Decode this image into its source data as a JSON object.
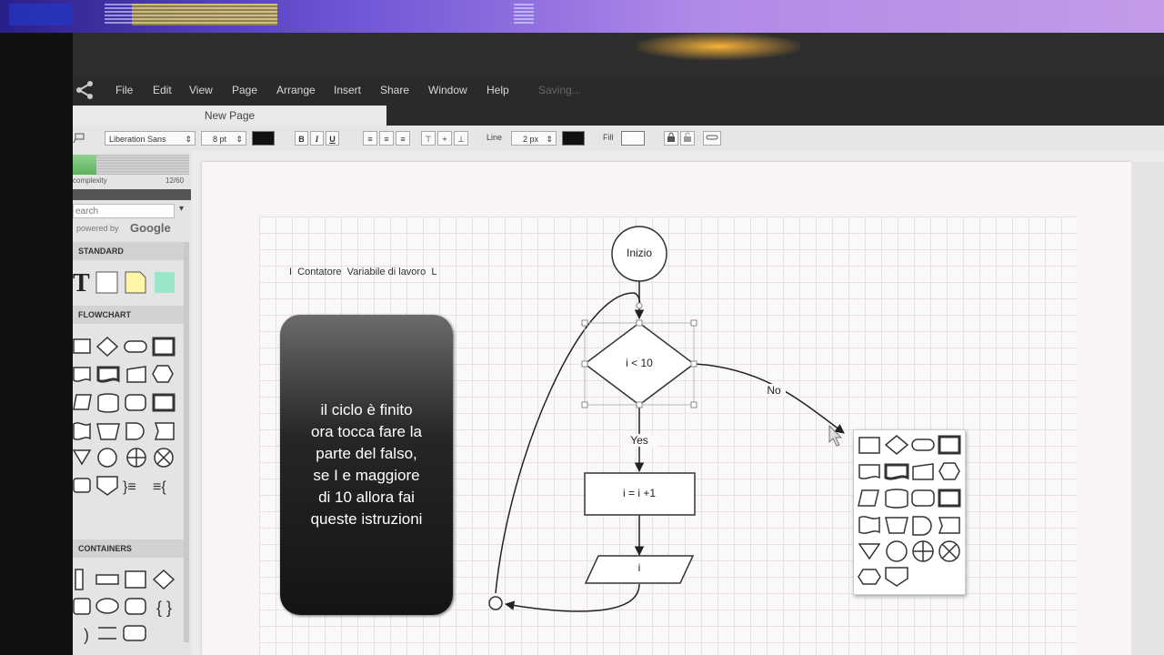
{
  "menu": {
    "items": [
      "File",
      "Edit",
      "View",
      "Page",
      "Arrange",
      "Insert",
      "Share",
      "Window",
      "Help"
    ],
    "status": "Saving..."
  },
  "tab": {
    "label": "New Page"
  },
  "toolbar": {
    "font": "Liberation Sans",
    "font_size": "8 pt",
    "bold": "B",
    "italic": "I",
    "underline": "U",
    "line_label": "Line",
    "line_width": "2 px",
    "fill_label": "Fill"
  },
  "sidebar": {
    "complexity_label": "complexity",
    "complexity_value": "12/60",
    "complexity_progress": 0.2,
    "search_placeholder": "earch",
    "powered_by": "powered by",
    "google": "Google",
    "sections": {
      "standard": "STANDARD",
      "flowchart": "FLOWCHART",
      "containers": "CONTAINERS"
    }
  },
  "canvas": {
    "note": "I  Contatore  Variabile di lavoro  L",
    "callout": "il ciclo è finito\nora tocca fare la\nparte del falso,\nse I e maggiore\ndi 10 allora fai\nqueste istruzioni",
    "start": "Inizio",
    "decision": "i < 10",
    "yes": "Yes",
    "no": "No",
    "process": "i = i +1",
    "io": "i"
  },
  "colors": {
    "menubar": "#2a2a2a",
    "accent": "#f7b23a",
    "callout": "#1c1c1c",
    "mint": "#9ae6c8",
    "note_yellow": "#fff6a8"
  }
}
